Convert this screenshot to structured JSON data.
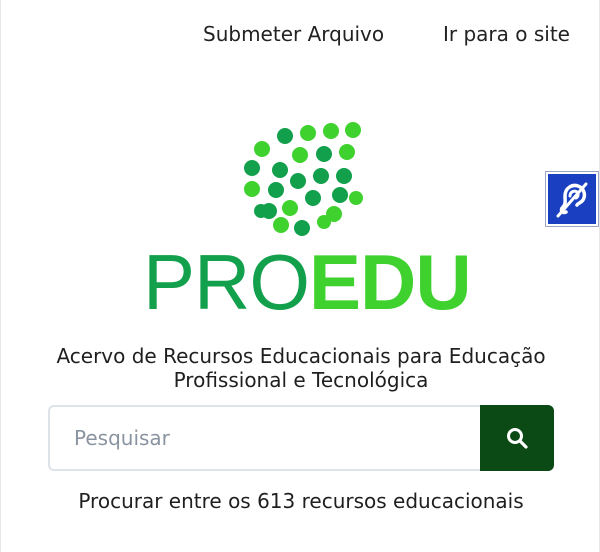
{
  "nav": {
    "submit_label": "Submeter Arquivo",
    "site_label": "Ir para o site"
  },
  "accessibility": {
    "icon": "hearing-accessibility-icon",
    "color": "#1a3fc0"
  },
  "logo": {
    "pro": "PRO",
    "edu": "EDU",
    "colors": {
      "dark_green": "#12a04c",
      "light_green": "#3fd12e"
    }
  },
  "tagline": {
    "line1": "Acervo de Recursos Educacionais para Educação",
    "line2": "Profissional e Tecnológica"
  },
  "search": {
    "placeholder": "Pesquisar",
    "value": "",
    "button_icon": "search-icon",
    "button_color": "#0b4a14"
  },
  "resources": {
    "text": "Procurar entre os 613 recursos educacionais"
  }
}
